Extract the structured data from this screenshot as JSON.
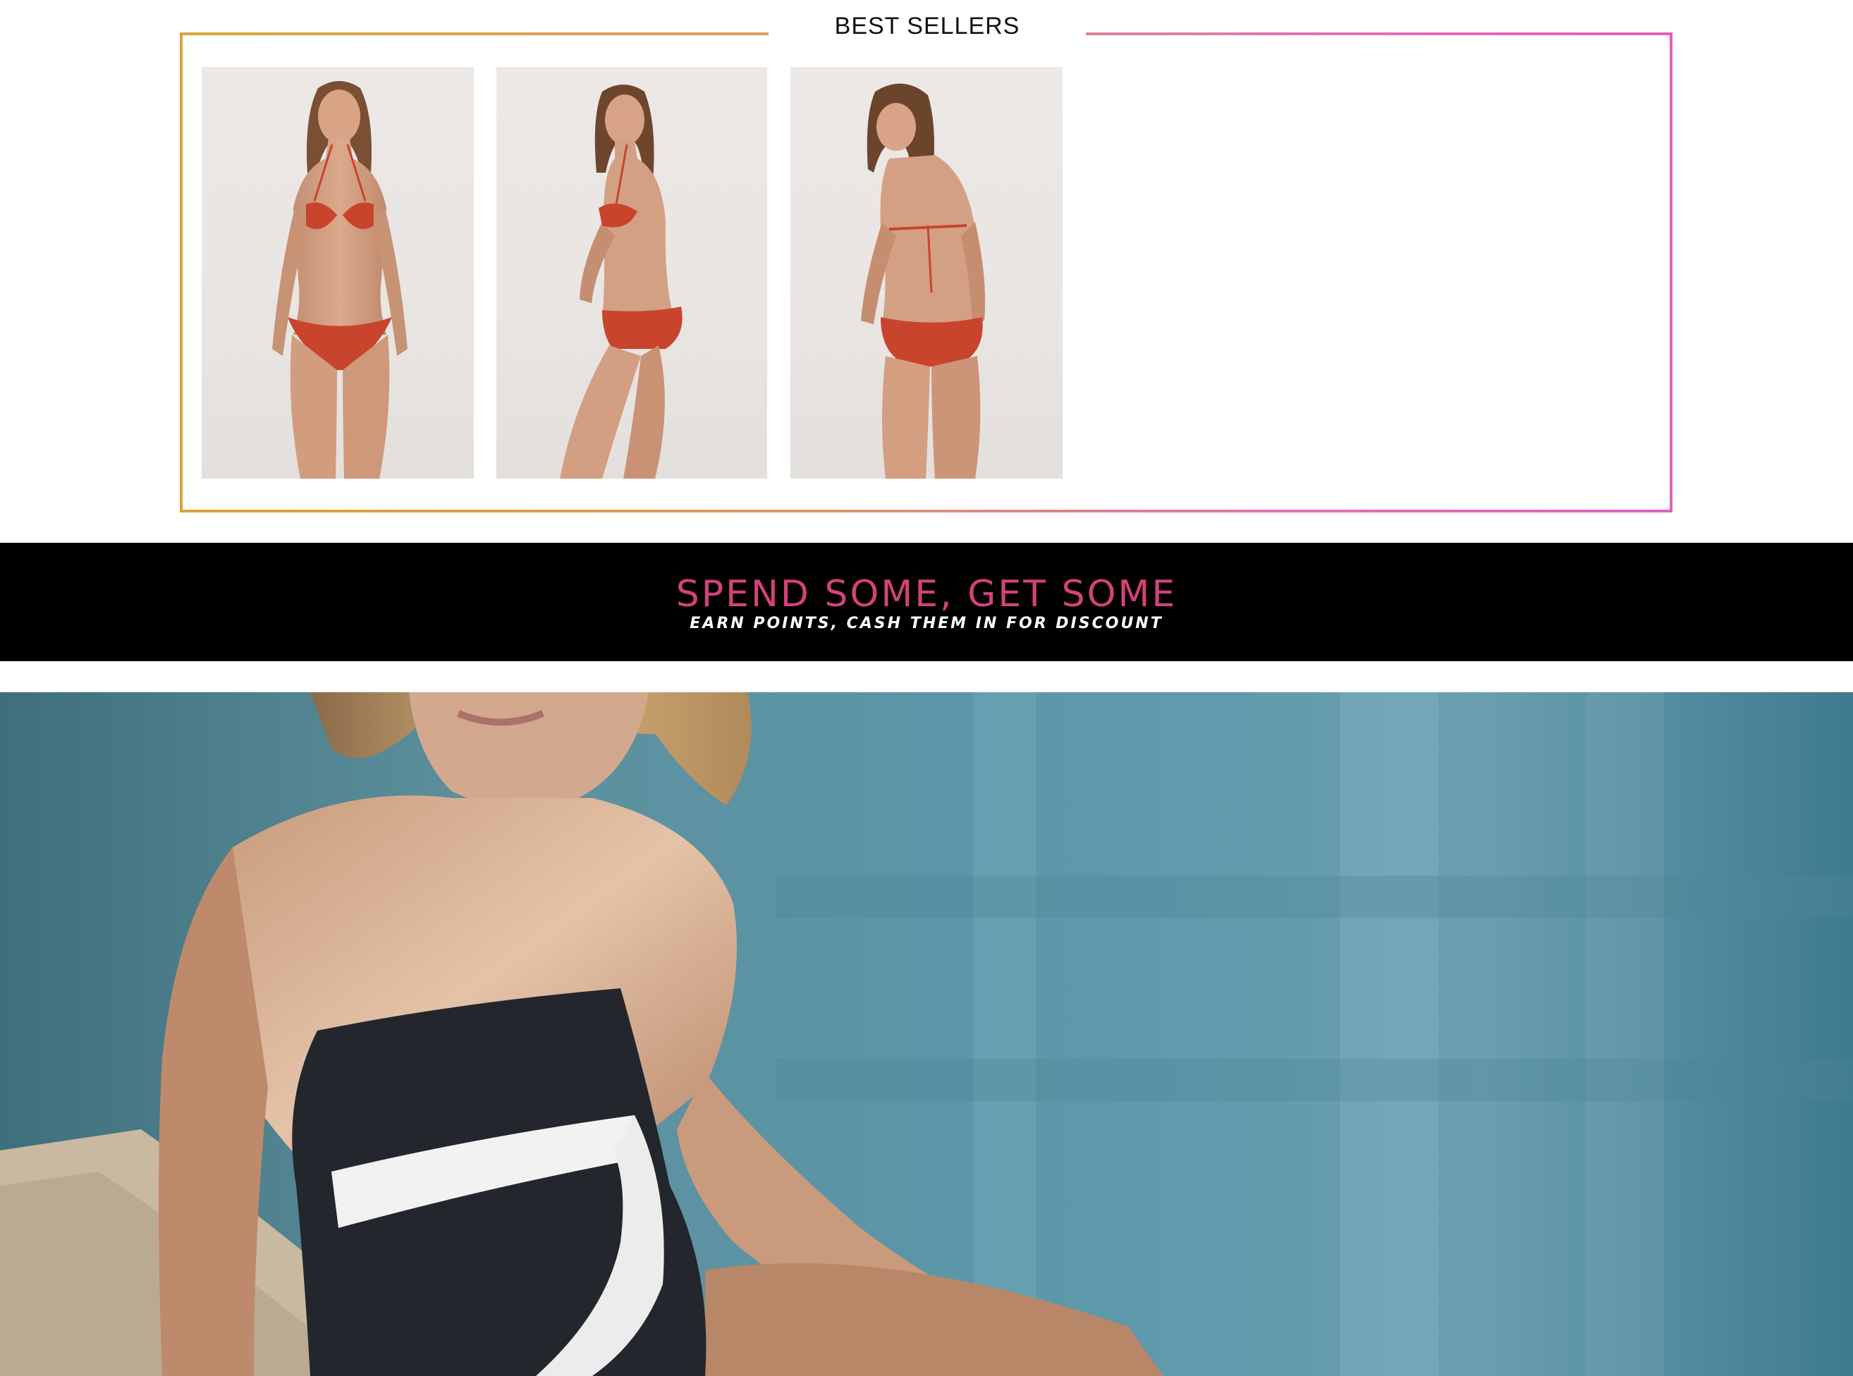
{
  "best_sellers": {
    "title": "BEST SELLERS",
    "products": [
      {
        "image": "model-front-red-bikini"
      },
      {
        "image": "model-side-red-bikini"
      },
      {
        "image": "model-back-red-bikini"
      }
    ]
  },
  "promo": {
    "title": "SPEND SOME, GET SOME",
    "subtitle": "EARN POINTS, CASH THEM IN FOR DISCOUNT",
    "title_color": "#d2427a",
    "background": "#000000"
  },
  "hero": {
    "image": "model-black-white-swimsuit-poolside"
  },
  "colors": {
    "frame_gradient_start": "#d6a734",
    "frame_gradient_end": "#e15fc0",
    "bikini_red": "#c9442d"
  }
}
